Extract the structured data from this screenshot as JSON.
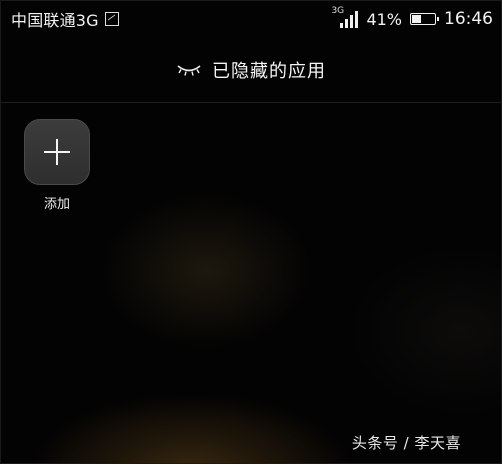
{
  "status_bar": {
    "carrier": "中国联通3G",
    "network_type": "3G",
    "battery_percent": "41%",
    "battery_level": 0.41,
    "time": "16:46"
  },
  "header": {
    "title": "已隐藏的应用",
    "icon": "closed-eye-icon"
  },
  "add_tile": {
    "label": "添加",
    "icon": "plus-icon"
  },
  "watermark": {
    "text": "头条号 / 李天喜"
  },
  "colors": {
    "background": "#000000",
    "text": "#ffffff",
    "tile_background": "#333333"
  }
}
